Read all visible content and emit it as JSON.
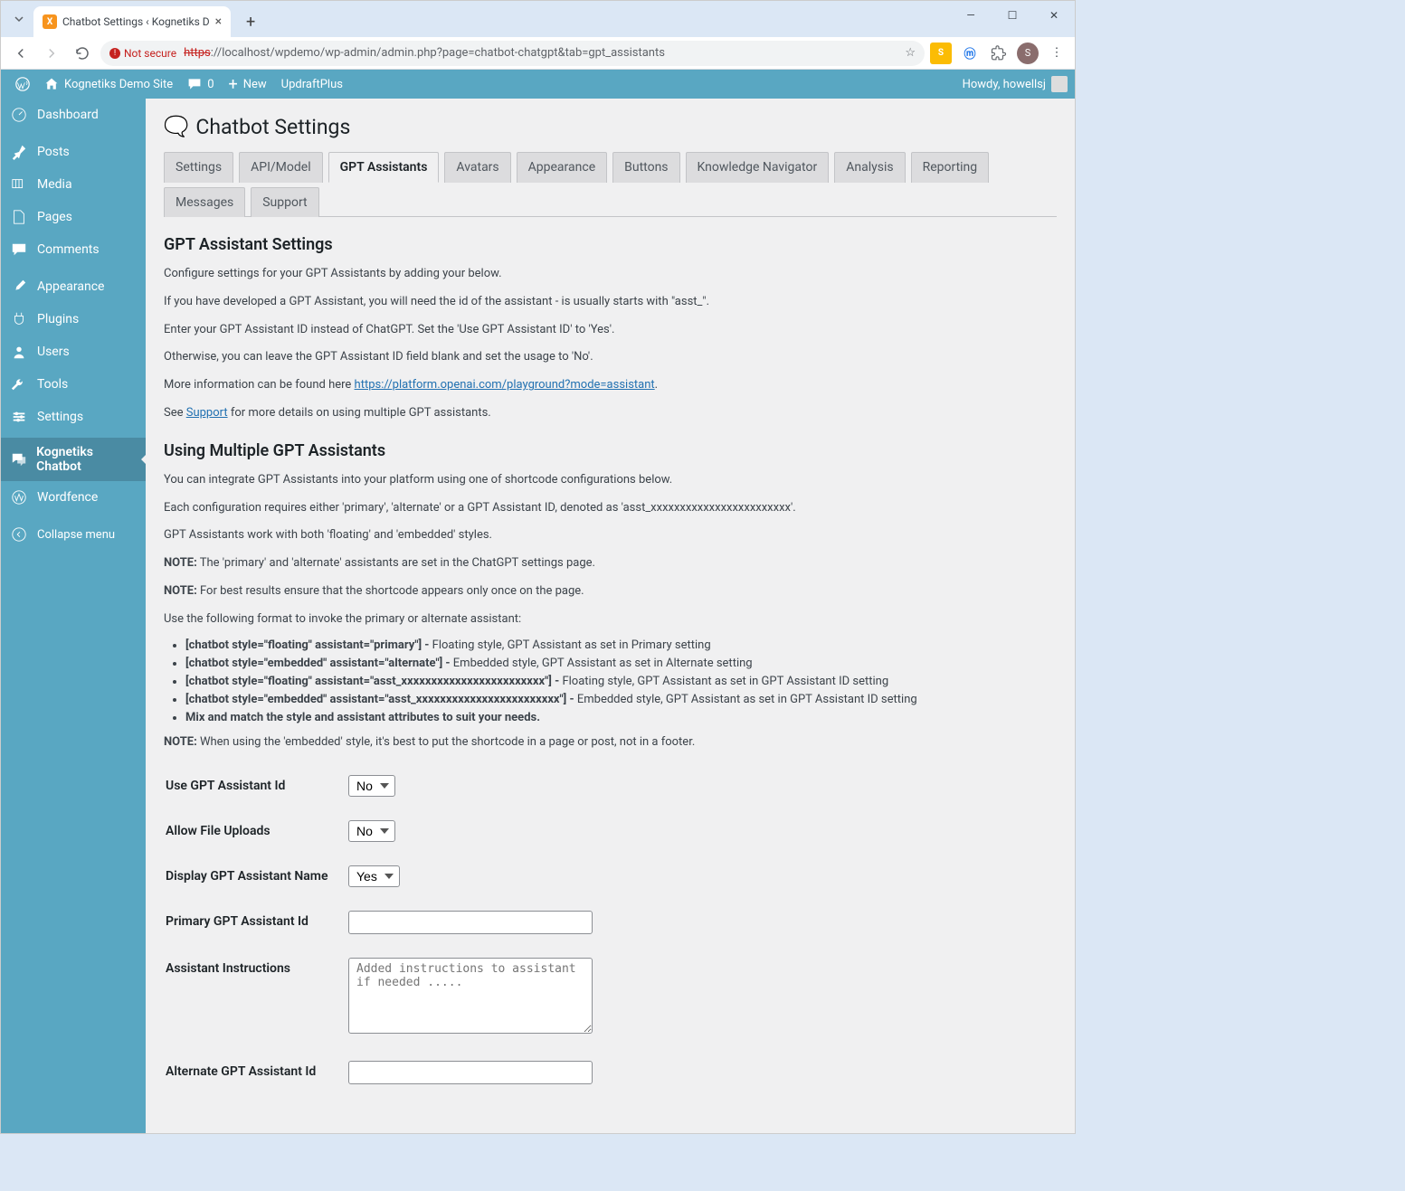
{
  "browser": {
    "tab_title": "Chatbot Settings ‹ Kognetiks D",
    "new_tab": "+",
    "url_https": "https",
    "url_rest": "://localhost/wpdemo/wp-admin/admin.php?page=chatbot-chatgpt&tab=gpt_assistants",
    "url_host_part": "localhost",
    "not_secure": "Not secure",
    "avatar_letter": "S",
    "win_min": "—",
    "win_max": "☐",
    "win_close": "✕"
  },
  "adminbar": {
    "site_name": "Kognetiks Demo Site",
    "comments": "0",
    "new": "New",
    "updraft": "UpdraftPlus",
    "howdy": "Howdy, howellsj"
  },
  "menu": {
    "dashboard": "Dashboard",
    "posts": "Posts",
    "media": "Media",
    "pages": "Pages",
    "comments": "Comments",
    "appearance": "Appearance",
    "plugins": "Plugins",
    "users": "Users",
    "tools": "Tools",
    "settings": "Settings",
    "chatbot": "Kognetiks Chatbot",
    "wordfence": "Wordfence",
    "collapse": "Collapse menu"
  },
  "page": {
    "title": "Chatbot Settings",
    "tabs": {
      "settings": "Settings",
      "api": "API/Model",
      "gpt": "GPT Assistants",
      "avatars": "Avatars",
      "appearance": "Appearance",
      "buttons": "Buttons",
      "knowledge": "Knowledge Navigator",
      "analysis": "Analysis",
      "reporting": "Reporting",
      "messages": "Messages",
      "support": "Support"
    },
    "h2_1": "GPT Assistant Settings",
    "p1": "Configure settings for your GPT Assistants by adding your below.",
    "p2": "If you have developed a GPT Assistant, you will need the id of the assistant - is usually starts with \"asst_\".",
    "p3": "Enter your GPT Assistant ID instead of ChatGPT. Set the 'Use GPT Assistant ID' to 'Yes'.",
    "p4": "Otherwise, you can leave the GPT Assistant ID field blank and set the usage to 'No'.",
    "p5_pre": "More information can be found here ",
    "p5_link": "https://platform.openai.com/playground?mode=assistant",
    "p5_post": ".",
    "p6_pre": "See ",
    "p6_link": "Support",
    "p6_post": " for more details on using multiple GPT assistants.",
    "h2_2": "Using Multiple GPT Assistants",
    "p7": "You can integrate GPT Assistants into your platform using one of shortcode configurations below.",
    "p8": "Each configuration requires either 'primary', 'alternate' or a GPT Assistant ID, denoted as 'asst_xxxxxxxxxxxxxxxxxxxxxxxx'.",
    "p9": "GPT Assistants work with both 'floating' and 'embedded' styles.",
    "note_label": "NOTE:",
    "p10": " The 'primary' and 'alternate' assistants are set in the ChatGPT settings page.",
    "p11": " For best results ensure that the shortcode appears only once on the page.",
    "p12": "Use the following format to invoke the primary or alternate assistant:",
    "sc1_code": "[chatbot style=\"floating\" assistant=\"primary\"] -",
    "sc1_desc": " Floating style, GPT Assistant as set in Primary setting",
    "sc2_code": "[chatbot style=\"embedded\" assistant=\"alternate\"] -",
    "sc2_desc": " Embedded style, GPT Assistant as set in Alternate setting",
    "sc3_code": "[chatbot style=\"floating\" assistant=\"asst_xxxxxxxxxxxxxxxxxxxxxxxx\"] -",
    "sc3_desc": " Floating style, GPT Assistant as set in GPT Assistant ID setting",
    "sc4_code": "[chatbot style=\"embedded\" assistant=\"asst_xxxxxxxxxxxxxxxxxxxxxxxx\"] -",
    "sc4_desc": " Embedded style, GPT Assistant as set in GPT Assistant ID setting",
    "sc5": "Mix and match the style and assistant attributes to suit your needs.",
    "p13": " When using the 'embedded' style, it's best to put the shortcode in a page or post, not in a footer.",
    "form": {
      "use_id_label": "Use GPT Assistant Id",
      "use_id_value": "No",
      "file_uploads_label": "Allow File Uploads",
      "file_uploads_value": "No",
      "display_name_label": "Display GPT Assistant Name",
      "display_name_value": "Yes",
      "primary_id_label": "Primary GPT Assistant Id",
      "instructions_label": "Assistant Instructions",
      "instructions_placeholder": "Added instructions to assistant if needed .....",
      "alternate_id_label": "Alternate GPT Assistant Id"
    }
  }
}
